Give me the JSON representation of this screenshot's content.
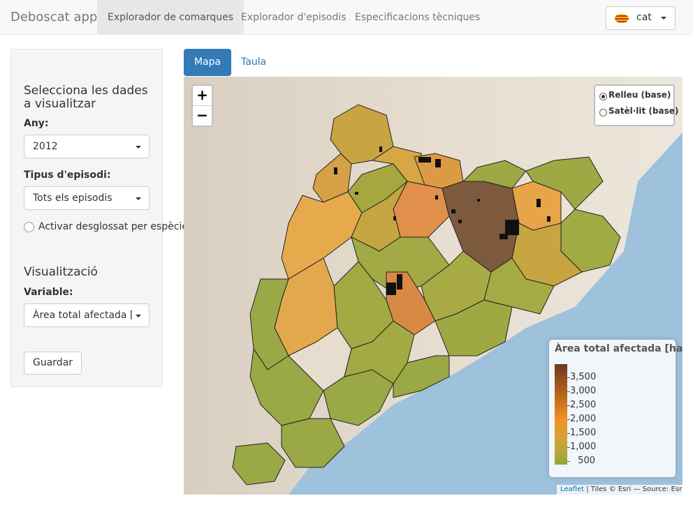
{
  "navbar": {
    "brand": "Deboscat app",
    "items": [
      {
        "label": "Explorador de comarques",
        "active": true
      },
      {
        "label": "Explorador d'episodis",
        "active": false
      },
      {
        "label": "Especificacions tècniques",
        "active": false
      }
    ],
    "language": {
      "label": "cat",
      "icon": "catalan-flag-icon"
    }
  },
  "sidebar": {
    "data_title": "Selecciona les dades a visualitzar",
    "year": {
      "label": "Any:",
      "value": "2012"
    },
    "episode_type": {
      "label": "Tipus d'episodi:",
      "value": "Tots els episodis"
    },
    "species_toggle": {
      "label": "Activar desglossat per espècies",
      "checked": false
    },
    "viz_title": "Visualització",
    "variable": {
      "label": "Variable:",
      "value": "Àrea total afectada [ha]"
    },
    "save_label": "Guardar"
  },
  "tabs": [
    {
      "label": "Mapa",
      "active": true
    },
    {
      "label": "Taula",
      "active": false
    }
  ],
  "map": {
    "zoom_in": "+",
    "zoom_out": "−",
    "layers": [
      {
        "label": "Relleu (base)",
        "selected": true
      },
      {
        "label": "Satèl·lit (base)",
        "selected": false
      }
    ],
    "legend": {
      "title": "Àrea total afectada [ha]",
      "ticks": [
        "3,500",
        "3,000",
        "2,500",
        "2,000",
        "1,500",
        "1,000",
        "500"
      ],
      "colors": {
        "high": "#6b3a1f",
        "mid": "#ef9323",
        "low": "#98a43c"
      }
    },
    "attribution": {
      "link": "Leaflet",
      "text": " | Tiles © Esri — Source: Esri"
    },
    "colors": {
      "sea": "#9ec1dc",
      "land": "#e9e2d6",
      "green": "#9aa845",
      "orange": "#e9a648",
      "dark": "#7e5a3e"
    }
  }
}
